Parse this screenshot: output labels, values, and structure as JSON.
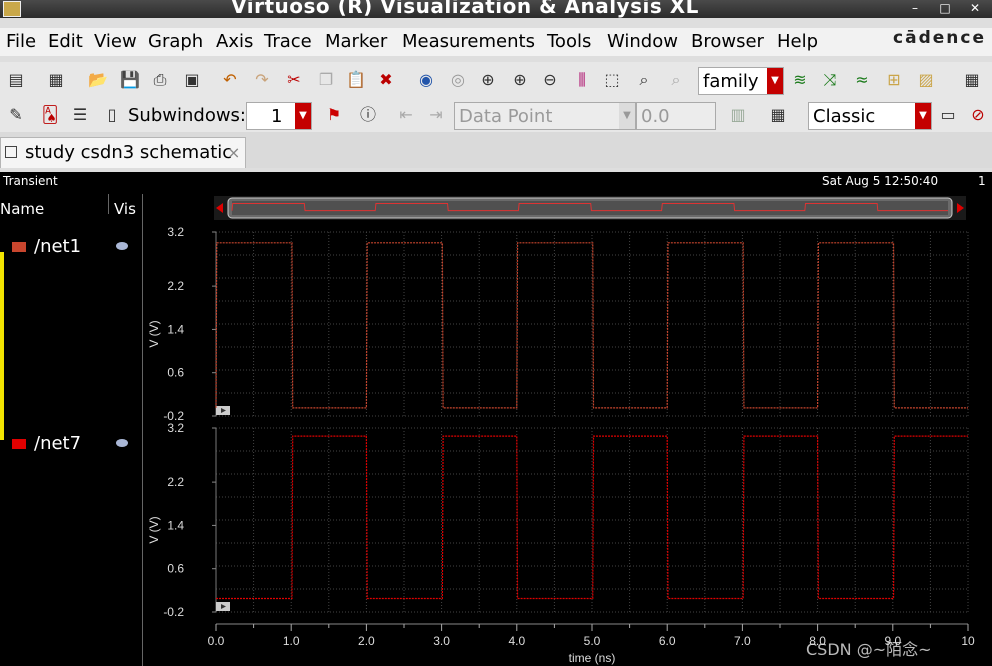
{
  "window": {
    "title": "Virtuoso (R) Visualization & Analysis XL",
    "controls": [
      "–",
      "□",
      "✕"
    ]
  },
  "menu": {
    "items": [
      "File",
      "Edit",
      "View",
      "Graph",
      "Axis",
      "Trace",
      "Marker",
      "Measurements",
      "Tools",
      "Window",
      "Browser",
      "Help"
    ],
    "brand": "cādence"
  },
  "toolbar": {
    "family_select": "family",
    "subwindows_label": "Subwindows:",
    "subwindows_value": "1",
    "data_point_label": "Data Point",
    "data_value": "0.0",
    "style_select": "Classic"
  },
  "tab": {
    "label": "study csdn3 schematic",
    "close": "×"
  },
  "canvas": {
    "analysis": "Transient",
    "timestamp": "Sat Aug 5 12:50:40",
    "page_number": "1",
    "legend_header_name": "Name",
    "legend_header_vis": "Vis"
  },
  "traces": [
    {
      "name": "/net1",
      "color": "#c8462e"
    },
    {
      "name": "/net7",
      "color": "#e00000"
    }
  ],
  "chart_data": [
    {
      "type": "line",
      "title": "",
      "xlabel": "time (ns)",
      "ylabel": "V (V)",
      "xlim": [
        0,
        10
      ],
      "ylim": [
        -0.2,
        3.2
      ],
      "y_ticks": [
        "3.2",
        "2.2",
        "1.4",
        "0.6",
        "-0.2"
      ],
      "grid": true,
      "series": [
        {
          "name": "/net1",
          "x": [
            0,
            0.01,
            1.01,
            1.02,
            2.0,
            2.01,
            3.01,
            3.02,
            4.0,
            4.01,
            5.01,
            5.02,
            6.0,
            6.01,
            7.01,
            7.02,
            8.0,
            8.01,
            9.01,
            9.02,
            10
          ],
          "values": [
            -0.05,
            3.0,
            3.0,
            -0.05,
            -0.05,
            3.0,
            3.0,
            -0.05,
            -0.05,
            3.0,
            3.0,
            -0.05,
            -0.05,
            3.0,
            3.0,
            -0.05,
            -0.05,
            3.0,
            3.0,
            -0.05,
            -0.05
          ]
        }
      ]
    },
    {
      "type": "line",
      "title": "",
      "xlabel": "time (ns)",
      "ylabel": "V (V)",
      "xlim": [
        0,
        10
      ],
      "ylim": [
        -0.2,
        3.2
      ],
      "y_ticks": [
        "3.2",
        "2.2",
        "1.4",
        "0.6",
        "-0.2"
      ],
      "x_ticks": [
        "0.0",
        "1.0",
        "2.0",
        "3.0",
        "4.0",
        "5.0",
        "6.0",
        "7.0",
        "8.0",
        "9.0",
        "10"
      ],
      "grid": true,
      "series": [
        {
          "name": "/net7",
          "x": [
            0,
            1.01,
            1.02,
            2.0,
            2.01,
            3.01,
            3.02,
            4.0,
            4.01,
            5.01,
            5.02,
            6.0,
            6.01,
            7.01,
            7.02,
            8.0,
            8.01,
            9.01,
            9.02,
            10
          ],
          "values": [
            0.05,
            0.05,
            3.05,
            3.05,
            0.05,
            0.05,
            3.05,
            3.05,
            0.05,
            0.05,
            3.05,
            3.05,
            0.05,
            0.05,
            3.05,
            3.05,
            0.05,
            0.05,
            3.05,
            3.05
          ]
        }
      ]
    }
  ],
  "watermark": "CSDN @~陌念~"
}
